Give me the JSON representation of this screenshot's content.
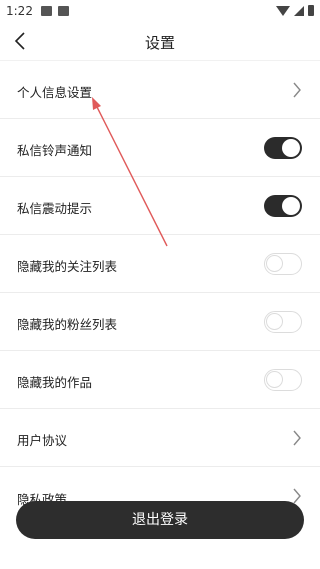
{
  "status_bar": {
    "time": "1:22"
  },
  "header": {
    "title": "设置",
    "back_icon": "chevron-left-icon"
  },
  "settings": [
    {
      "label": "个人信息设置",
      "control": "chevron"
    },
    {
      "label": "私信铃声通知",
      "control": "toggle",
      "on": true
    },
    {
      "label": "私信震动提示",
      "control": "toggle",
      "on": true
    },
    {
      "label": "隐藏我的关注列表",
      "control": "toggle",
      "on": false
    },
    {
      "label": "隐藏我的粉丝列表",
      "control": "toggle",
      "on": false
    },
    {
      "label": "隐藏我的作品",
      "control": "toggle",
      "on": false
    },
    {
      "label": "用户协议",
      "control": "chevron"
    },
    {
      "label": "隐私政策",
      "control": "chevron"
    }
  ],
  "logout_button": {
    "label": "退出登录"
  },
  "colors": {
    "toggle_on": "#2b2b2b",
    "annotation_arrow": "#e05a5a",
    "button_bg": "#2d2d2d"
  }
}
